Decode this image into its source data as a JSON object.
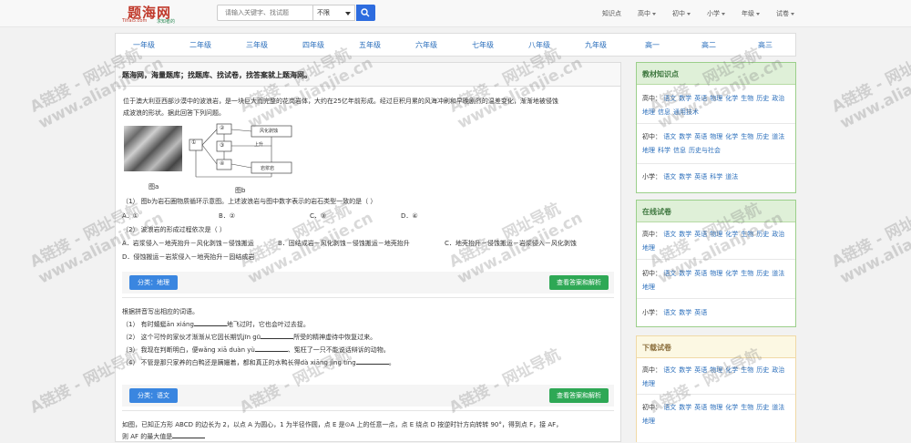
{
  "logo": {
    "title": "题海网",
    "domain": "Tihai5.com",
    "slogan": "求知者的"
  },
  "search": {
    "placeholder": "请输入关键字、找试题",
    "type": "不限"
  },
  "top_menu": [
    "知识点",
    "高中",
    "初中",
    "小学",
    "年级",
    "试卷"
  ],
  "grades": [
    "一年级",
    "二年级",
    "三年级",
    "四年级",
    "五年级",
    "六年级",
    "七年级",
    "八年级",
    "九年级",
    "高一",
    "高二",
    "高三"
  ],
  "main": {
    "header": "题海网，海量题库；找题库、找试卷，找答案就上题海网。",
    "q1": {
      "stem1": "位于澳大利亚西部沙漠中的波浪岩，是一块巨大而完整的花岗岩体，大约在25亿年前形成。经过巨积月累的风海冲刷和早晚剧烈的温差变化，渐渐地被侵蚀",
      "stem2": "成波浪的形状。据此回答下列问题。",
      "fig_a": "图a",
      "fig_b": "图b",
      "diagram": {
        "n1": "①",
        "n2": "②",
        "n3": "③",
        "n4": "④",
        "box1": "风化剥蚀",
        "box2": "上升",
        "box3": "岩浆岩"
      },
      "sub1": "（1） 图b为岩石圈物质循环示意图。上述波浪岩与图中数字表示的岩石类型一致的是（    ）",
      "sub1_opts": [
        "A．①",
        "B．②",
        "C．③",
        "D．④"
      ],
      "sub2": "（2） 波浪岩的形成过程依次是（    ）",
      "sub2_a": "A．岩浆侵入－地壳抬升－风化剥蚀－侵蚀搬运",
      "sub2_b": "B．固结成岩－风化剥蚀－侵蚀搬运－地壳抬升",
      "sub2_c": "C．地壳抬升－侵蚀搬运－岩浆侵入－风化剥蚀",
      "sub2_d": "D．侵蚀搬运－岩浆侵入－地壳抬升－固结成岩",
      "category": "分类：地理",
      "answer": "查看答案和解析"
    },
    "q2": {
      "stem": "根据拼音写出相应的词语。",
      "l1a": "（1） 有时蜻蜓ān xiáng",
      "l1b": "地飞过时，它也会叶过去捉。",
      "l2a": "（2） 这个可怜的家伙才渐渐从它因长期饥jīn gū",
      "l2b": "所受的精神虚待中恢复过来。",
      "l3a": "（3） 我现在判断明白，便wǎng xiā duàn yù",
      "l3b": "、冤枉了一只不能说话辩诉的动物。",
      "l4a": "（4） 不管是那只家养的白鸭还是蹒姗着，都和真正的水鸭长得dà xiāng jìng tíng",
      "l4b": "。",
      "category": "分类：语文",
      "answer": "查看答案和解析"
    },
    "q3": {
      "stem1": "如图，已知正方形 ABCD 的边长为 2，以点 A 为圆心，1 为半径作圆，点 E 是⊙A 上的任意一点，点 E 绕点 D 按逆时针方向转转 90°，得到点 F，接 AF，",
      "stem2": "则 AF 的最大值是"
    }
  },
  "sidebar": {
    "knowledge": {
      "title": "教材知识点",
      "high_label": "高中：",
      "high": [
        "语文",
        "数学",
        "英语",
        "物理",
        "化学",
        "生物",
        "历史",
        "政治",
        "地理",
        "信息",
        "通用技术"
      ],
      "middle_label": "初中：",
      "middle": [
        "语文",
        "数学",
        "英语",
        "物理",
        "化学",
        "生物",
        "历史",
        "道法",
        "地理",
        "科学",
        "信息",
        "历史与社会"
      ],
      "primary_label": "小学：",
      "primary": [
        "语文",
        "数学",
        "英语",
        "科学",
        "道法"
      ]
    },
    "online": {
      "title": "在线试卷",
      "high_label": "高中：",
      "high": [
        "语文",
        "数学",
        "英语",
        "物理",
        "化学",
        "生物",
        "历史",
        "政治",
        "地理"
      ],
      "middle_label": "初中：",
      "middle": [
        "语文",
        "数学",
        "英语",
        "物理",
        "化学",
        "生物",
        "历史",
        "道法",
        "地理"
      ],
      "primary_label": "小学：",
      "primary": [
        "语文",
        "数学",
        "英语"
      ]
    },
    "download": {
      "title": "下载试卷",
      "high_label": "高中：",
      "high": [
        "语文",
        "数学",
        "英语",
        "物理",
        "化学",
        "生物",
        "历史",
        "政治",
        "地理"
      ],
      "middle_label": "初中：",
      "middle": [
        "语文",
        "数学",
        "英语",
        "物理",
        "化学",
        "生物",
        "历史",
        "道法",
        "地理"
      ]
    }
  },
  "watermark": {
    "line1": "A链接 - 网址导航",
    "line2": "www.alianjie.cn"
  }
}
